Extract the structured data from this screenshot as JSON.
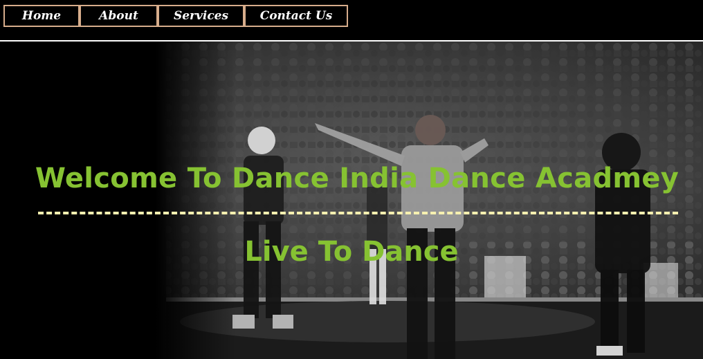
{
  "nav": {
    "items": [
      {
        "label": "Home"
      },
      {
        "label": "About"
      },
      {
        "label": "Services"
      },
      {
        "label": "Contact Us"
      }
    ]
  },
  "hero": {
    "title": "Welcome To Dance India Dance Acadmey",
    "tagline": "Live To Dance"
  },
  "colors": {
    "background": "#000000",
    "nav_border": "#d7ad8c",
    "heading_green": "#86c232",
    "divider": "#f6f0b0"
  }
}
